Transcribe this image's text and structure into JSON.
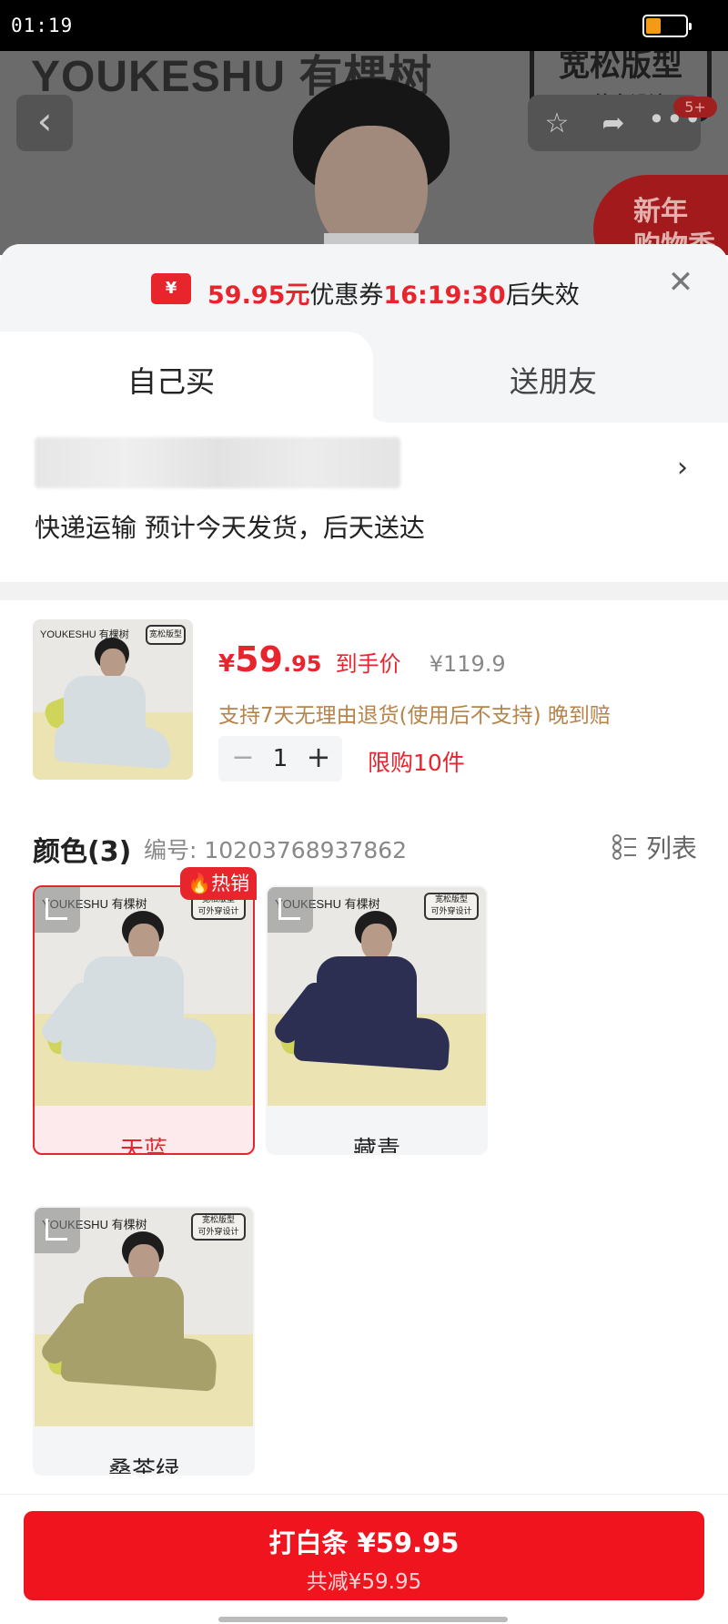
{
  "status_bar": {
    "time": "01:19"
  },
  "background_header": {
    "brand_text": "YOUKESHU 有棵树",
    "badge_line1": "宽松版型",
    "badge_line2": "可外穿设计",
    "notification_count": "5+",
    "promo_line1": "新年",
    "promo_line2": "购物季"
  },
  "coupon": {
    "icon_symbol": "¥",
    "amount": "59.95元",
    "label": "优惠券",
    "countdown": "16:19:30",
    "suffix": "后失效"
  },
  "tabs": [
    {
      "label": "自己买",
      "active": true
    },
    {
      "label": "送朋友",
      "active": false
    }
  ],
  "address": {
    "delivery": "快递运输 预计今天发货，后天送达"
  },
  "product": {
    "currency": "¥",
    "price_int": "59",
    "price_dec": ".95",
    "price_tag": "到手价",
    "original_price": "¥119.9",
    "return_policy": "支持7天无理由退货(使用后不支持)  晚到赔",
    "quantity": "1",
    "limit": "限购10件",
    "thumb_logo": "YOUKESHU 有棵树",
    "thumb_badge": "宽松版型"
  },
  "color_section": {
    "title": "颜色(3)",
    "code": "编号: 10203768937862",
    "list_toggle": "列表",
    "hot_badge": "热销",
    "options": [
      {
        "label": "天蓝",
        "selected": true,
        "garment_color": "#d6dde0"
      },
      {
        "label": "藏青",
        "selected": false,
        "garment_color": "#2c2f52"
      },
      {
        "label": "桑茶绿",
        "selected": false,
        "garment_color": "#a7a06a"
      }
    ],
    "photo_logo": "YOUKESHU 有棵树",
    "photo_badge_line1": "宽松版型",
    "photo_badge_line2": "可外穿设计"
  },
  "checkout": {
    "button_main": "打白条 ¥59.95",
    "button_sub": "共减¥59.95"
  },
  "colors": {
    "accent_red": "#e8242d",
    "pay_button": "#f0141e",
    "return_gold": "#b6844a"
  }
}
